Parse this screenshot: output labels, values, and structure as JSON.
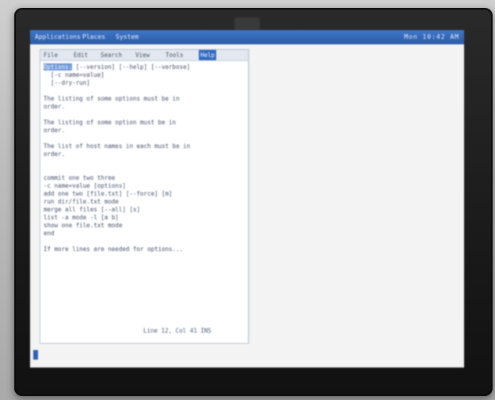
{
  "topbar": {
    "items": [
      "Applications",
      "Places",
      "System"
    ],
    "tray": "Mon 10:42 AM"
  },
  "editor": {
    "menu": [
      "File",
      "Edit",
      "Search",
      "View",
      "Tools",
      "Help"
    ],
    "active_menu_index": 5,
    "lines": [
      "Options: [--version] [--help] [--verbose]",
      "  [-c name=value]",
      "  [--dry-run]",
      "",
      "The listing of some options must be in",
      "order.",
      "",
      "The listing of some option must be in",
      "order.",
      "",
      "The list of host names in each must be in",
      "order.",
      "",
      "",
      "commit one two three",
      "-c name=value [options]",
      "add one two [file.txt] [--force] [m]",
      "run dir/file.txt mode",
      "merge all files [--all] [x]",
      "list -a mode -l [a b]",
      "show one file.txt mode",
      "end",
      "",
      "If more lines are needed for options..."
    ],
    "status": "Line 12, Col 41  INS"
  }
}
